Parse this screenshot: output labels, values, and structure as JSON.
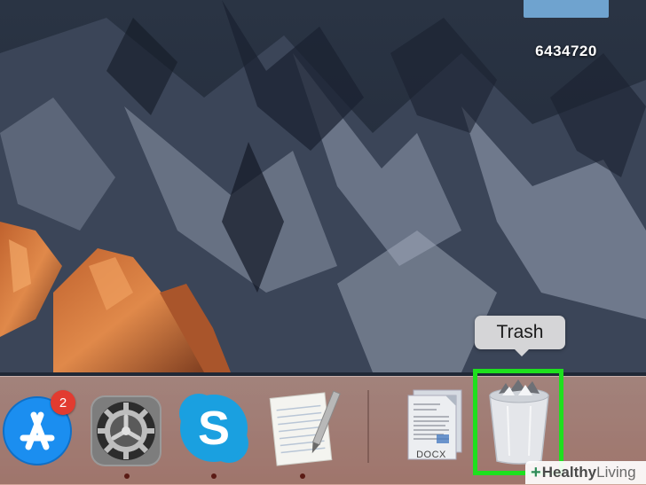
{
  "desktop": {
    "file_label": "6434720"
  },
  "dock": {
    "items": [
      {
        "name": "App Store",
        "icon": "app-store-icon",
        "badge": "2",
        "running": false
      },
      {
        "name": "System Preferences",
        "icon": "gear-icon",
        "running": true
      },
      {
        "name": "Skype",
        "icon": "skype-icon",
        "running": true
      },
      {
        "name": "TextEdit",
        "icon": "textedit-icon",
        "running": false
      },
      {
        "name": "Document",
        "icon": "document-icon",
        "file_type": "DOCX",
        "running": false
      },
      {
        "name": "Trash",
        "icon": "trash-icon",
        "running": false
      }
    ],
    "tooltip": "Trash"
  },
  "watermark": {
    "plus": "+",
    "part1": "Healthy",
    "part2": " Living"
  },
  "colors": {
    "highlight": "#1ee01e",
    "badge": "#e23b30",
    "skype": "#1aa0e0",
    "appstore": "#1b8ef0"
  }
}
